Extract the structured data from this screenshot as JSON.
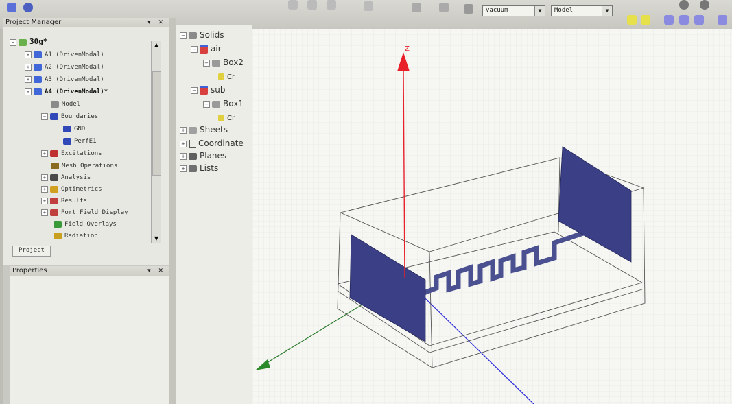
{
  "toolbar": {
    "material": "vacuum",
    "selection_mode": "Model"
  },
  "project_manager": {
    "title": "Project Manager",
    "title_buttons": "▾ ✕",
    "project_name": "30g*",
    "designs": [
      {
        "label": "A1 (DrivenModal)"
      },
      {
        "label": "A2 (DrivenModal)"
      },
      {
        "label": "A3 (DrivenModal)"
      },
      {
        "label": "A4 (DrivenModal)*"
      }
    ],
    "a4_children": {
      "model": "Model",
      "boundaries": "Boundaries",
      "gnd": "GND",
      "perfe": "PerfE1",
      "excitations": "Excitations",
      "mesh": "Mesh Operations",
      "analysis": "Analysis",
      "optimetrics": "Optimetrics",
      "results": "Results",
      "port_field": "Port Field Display",
      "field_overlays": "Field Overlays",
      "radiation": "Radiation"
    },
    "tab_label": "Project"
  },
  "properties": {
    "title": "Properties",
    "title_buttons": "▾ ✕"
  },
  "model_tree": {
    "solids": "Solids",
    "air": "air",
    "box2": "Box2",
    "cr1": "Cr",
    "sub": "sub",
    "box1": "Box1",
    "cr2": "Cr",
    "sheets": "Sheets",
    "coordinate": "Coordinate",
    "planes": "Planes",
    "lists": "Lists"
  },
  "viewport": {
    "z_axis_label": "Z",
    "colors": {
      "z_axis": "#e8202a",
      "x_axis": "#2a7a2a",
      "y_axis": "#2a2ad8",
      "port": "#3a3f86",
      "trace": "#4a5090"
    }
  }
}
